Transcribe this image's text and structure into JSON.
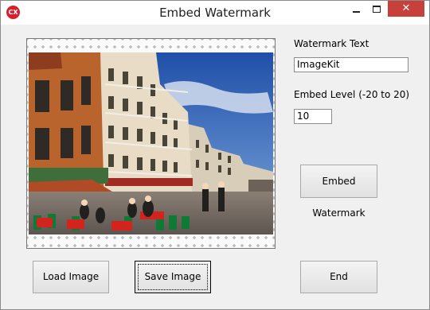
{
  "window": {
    "title": "Embed Watermark",
    "app_icon": "CX",
    "controls": {
      "minimize": "minimize-icon",
      "maximize": "maximize-icon",
      "close": "✕"
    }
  },
  "form": {
    "watermark_text_label": "Watermark Text",
    "watermark_text_value": "ImageKit",
    "embed_level_label": "Embed Level (-20 to 20)",
    "embed_level_value": "10"
  },
  "buttons": {
    "embed_watermark": "Embed Watermark",
    "load_image": "Load Image",
    "save_image": "Save Image",
    "end": "End"
  },
  "picture": {
    "background": "transparency-checkerboard",
    "content": "photo of a Venetian street café"
  }
}
